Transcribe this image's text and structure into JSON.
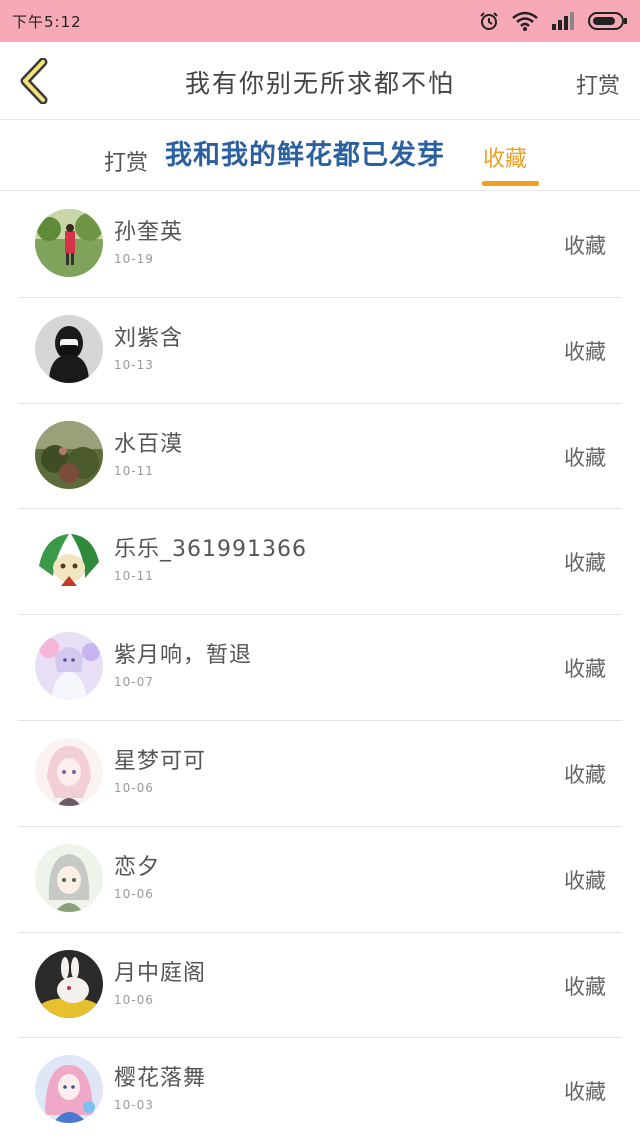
{
  "status_bar": {
    "time": "下午5:12",
    "icons": [
      "alarm-icon",
      "wifi-icon",
      "signal-icon",
      "battery-icon"
    ]
  },
  "header": {
    "back_icon": "chevron-left-icon",
    "title": "我有你别无所求都不怕",
    "action": "打赏"
  },
  "tabs": {
    "reward": "打赏",
    "overlay_text": "我和我的鲜花都已发芽",
    "collect": "收藏",
    "active": "collect",
    "accent_color": "#f0a020"
  },
  "list": {
    "items": [
      {
        "name": "孙奎英",
        "date": "10-19",
        "action": "收藏"
      },
      {
        "name": "刘紫含",
        "date": "10-13",
        "action": "收藏"
      },
      {
        "name": "水百漠",
        "date": "10-11",
        "action": "收藏"
      },
      {
        "name": "乐乐_361991366",
        "date": "10-11",
        "action": "收藏"
      },
      {
        "name": "紫月响，暂退",
        "date": "10-07",
        "action": "收藏"
      },
      {
        "name": "星梦可可",
        "date": "10-06",
        "action": "收藏"
      },
      {
        "name": "恋夕",
        "date": "10-06",
        "action": "收藏"
      },
      {
        "name": "月中庭阁",
        "date": "10-06",
        "action": "收藏"
      },
      {
        "name": "樱花落舞",
        "date": "10-03",
        "action": "收藏"
      }
    ]
  }
}
